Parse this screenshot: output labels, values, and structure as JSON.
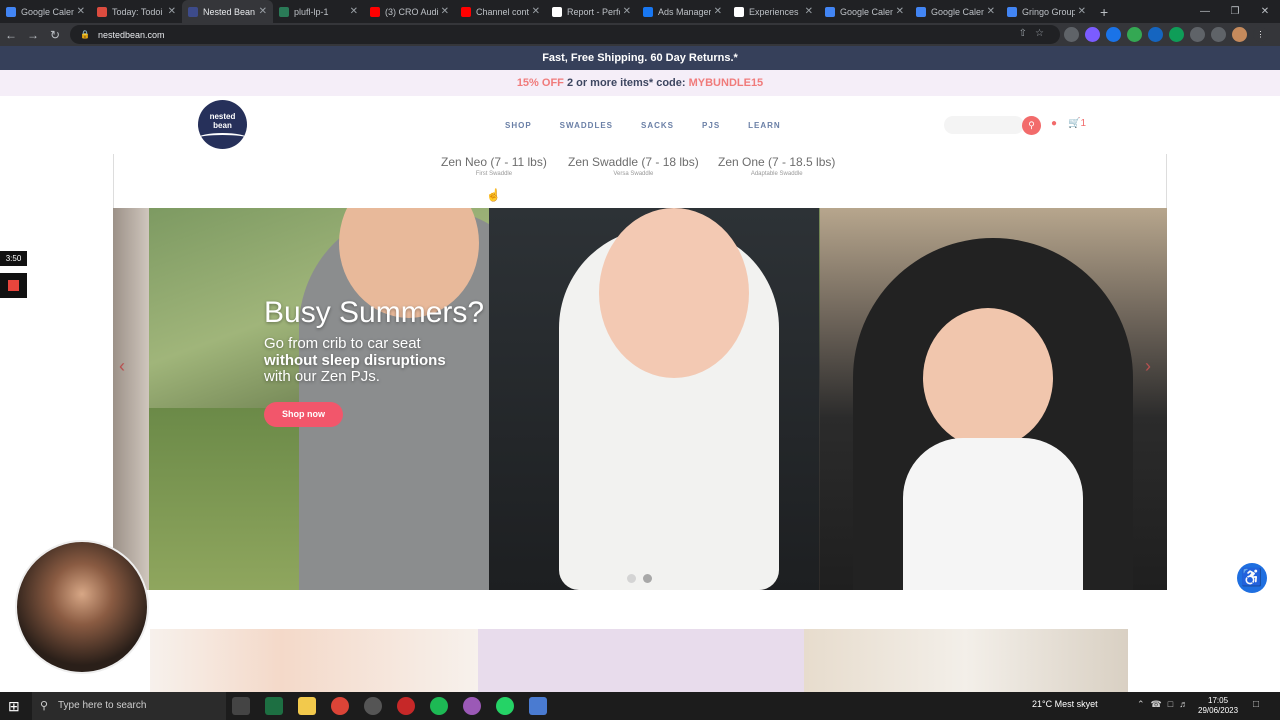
{
  "browser": {
    "tabs": [
      {
        "title": "Google Calen",
        "color": "#4285f4",
        "active": false
      },
      {
        "title": "Today: Todoi",
        "color": "#db4c3f",
        "active": false
      },
      {
        "title": "Nested Bean",
        "color": "#3d4b8a",
        "active": true
      },
      {
        "title": "plufl-lp-1",
        "color": "#2a7a57",
        "active": false
      },
      {
        "title": "(3) CRO Audi",
        "color": "#ff0000",
        "active": false
      },
      {
        "title": "Channel cont",
        "color": "#ff0000",
        "active": false
      },
      {
        "title": "Report - Perfo",
        "color": "#ffffff",
        "active": false
      },
      {
        "title": "Ads Manager",
        "color": "#1877f2",
        "active": false
      },
      {
        "title": "Experiences",
        "color": "#ffffff",
        "active": false
      },
      {
        "title": "Google Calen",
        "color": "#4285f4",
        "active": false
      },
      {
        "title": "Google Calen",
        "color": "#4285f4",
        "active": false
      },
      {
        "title": "Gringo Group",
        "color": "#4285f4",
        "active": false
      }
    ],
    "url": "nestedbean.com",
    "new_tab": "+"
  },
  "site": {
    "shipping_banner": "Fast, Free Shipping. 60 Day Returns.*",
    "promo": {
      "off": "15% OFF",
      "middle": " 2 or more items* code: ",
      "code": "MYBUNDLE15"
    },
    "logo": {
      "line1": "nested",
      "line2": "bean"
    },
    "nav": [
      "SHOP",
      "SWADDLES",
      "SACKS",
      "PJS",
      "LEARN"
    ],
    "cart_count": "1",
    "subnav": [
      {
        "name": "Zen Neo (7 - 11 lbs)",
        "sub": "First Swaddle"
      },
      {
        "name": "Zen Swaddle (7 - 18 lbs)",
        "sub": "Versa Swaddle"
      },
      {
        "name": "Zen One (7 - 18.5 lbs)",
        "sub": "Adaptable Swaddle"
      }
    ],
    "hero": {
      "title": "Busy Summers?",
      "line1": "Go from crib to car seat",
      "line2": "without sleep disruptions",
      "line3": "with our Zen PJs.",
      "cta": "Shop now"
    }
  },
  "recording": {
    "timer": "3:50"
  },
  "taskbar": {
    "search_placeholder": "Type here to search",
    "weather": "21°C  Mest skyet",
    "time": "17:05",
    "date": "29/06/2023"
  }
}
